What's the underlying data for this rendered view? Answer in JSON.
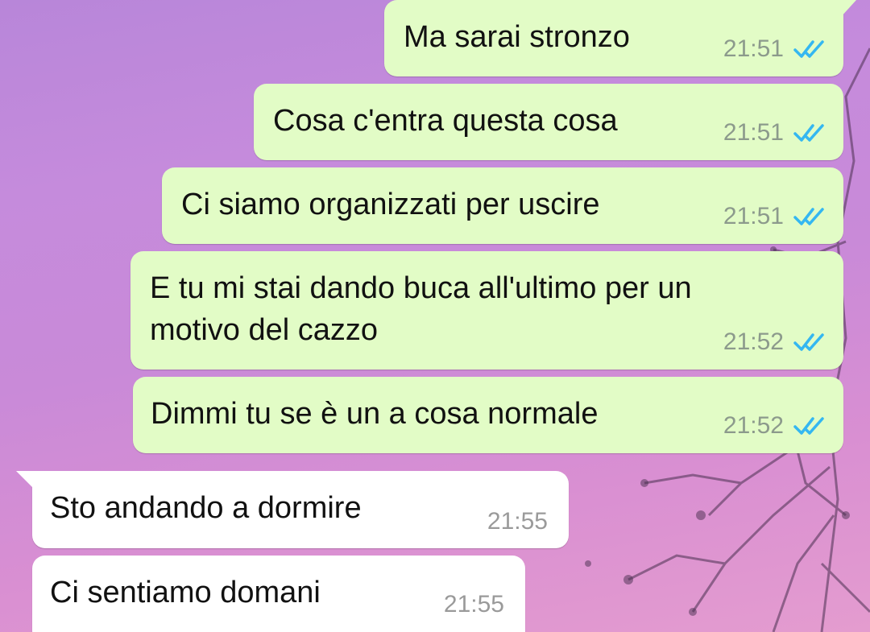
{
  "colors": {
    "outgoing_bubble": "#e2fcc6",
    "incoming_bubble": "#ffffff",
    "read_ticks": "#34b7f1",
    "wallpaper": "#c98ad8"
  },
  "messages": [
    {
      "direction": "outgoing",
      "text": "Ma sarai stronzo",
      "time": "21:51",
      "status_icon": "double-check-read-icon"
    },
    {
      "direction": "outgoing",
      "text": "Cosa c'entra questa cosa",
      "time": "21:51",
      "status_icon": "double-check-read-icon"
    },
    {
      "direction": "outgoing",
      "text": "Ci siamo organizzati per uscire",
      "time": "21:51",
      "status_icon": "double-check-read-icon"
    },
    {
      "direction": "outgoing",
      "text_line1": "E tu mi stai dando buca all'ultimo per un",
      "text_line2": "motivo del cazzo",
      "time": "21:52",
      "status_icon": "double-check-read-icon"
    },
    {
      "direction": "outgoing",
      "text": "Dimmi tu se è un a cosa normale",
      "time": "21:52",
      "status_icon": "double-check-read-icon"
    },
    {
      "direction": "incoming",
      "text": "Sto andando a dormire",
      "time": "21:55"
    },
    {
      "direction": "incoming",
      "text": "Ci sentiamo domani",
      "time": "21:55"
    }
  ]
}
